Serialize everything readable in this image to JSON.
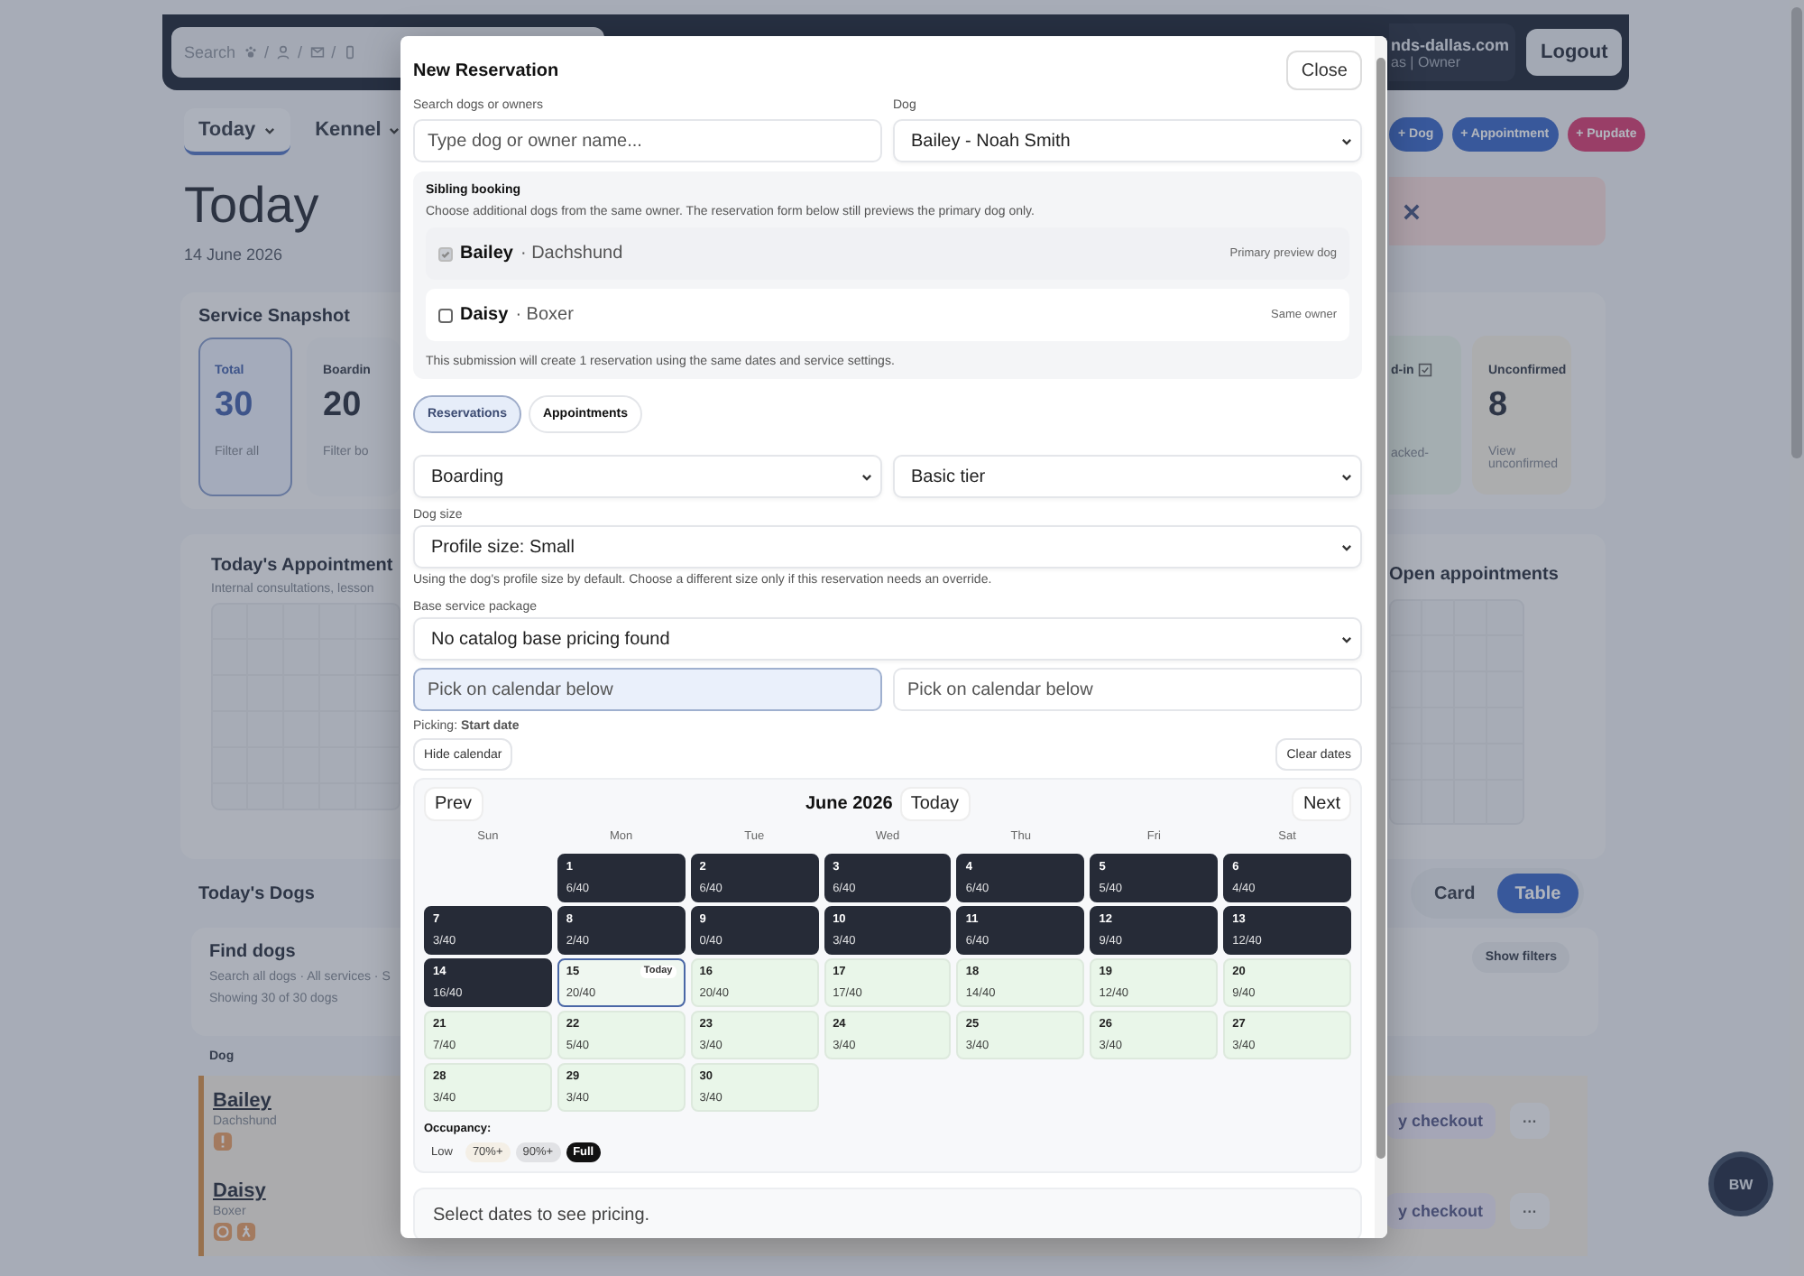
{
  "background": {
    "search": {
      "placeholder": "Search",
      "separator": "/"
    },
    "account": {
      "line1": "nds-dallas.com",
      "line2": "as | Owner"
    },
    "logout": "Logout",
    "nav_tabs": [
      {
        "label": "Today",
        "selected": true
      },
      {
        "label": "Kennel",
        "selected": false
      }
    ],
    "actions": [
      {
        "label": "+ Dog",
        "kind": "primary"
      },
      {
        "label": "+ Appointment",
        "kind": "primary"
      },
      {
        "label": "+ Pupdate",
        "kind": "accent"
      }
    ],
    "heading": "Today",
    "date": "14 June 2026",
    "snapshot": {
      "title": "Service Snapshot",
      "cards": [
        {
          "label": "Total",
          "value": "30",
          "link": "Filter all",
          "selected": true
        },
        {
          "label": "Boardin",
          "value": "20",
          "link": "Filter bo",
          "selected": false
        }
      ],
      "right_cards": [
        {
          "kind": "checkin",
          "label": "d-in",
          "link": "acked-"
        },
        {
          "kind": "unconfirmed",
          "label": "Unconfirmed",
          "value": "8",
          "link": "View unconfirmed"
        }
      ]
    },
    "appointments": {
      "title": "Today's Appointment",
      "subtitle": "Internal consultations, lesson",
      "side_title": "Open appointments"
    },
    "dogs": {
      "title": "Today's Dogs",
      "views": [
        {
          "label": "Card",
          "selected": false
        },
        {
          "label": "Table",
          "selected": true
        }
      ],
      "find_title": "Find dogs",
      "find_subtitle": "Search all dogs · All services · S",
      "showing": "Showing 30 of 30 dogs",
      "filters_button": "Show filters",
      "column": "Dog",
      "rows": [
        {
          "name": "Bailey",
          "breed": "Dachshund",
          "tags": [
            {
              "kind": "alert"
            }
          ],
          "action": "y checkout",
          "more": "···"
        },
        {
          "name": "Daisy",
          "breed": "Boxer",
          "tags": [
            {
              "kind": "food"
            },
            {
              "kind": "walk"
            }
          ],
          "action": "y checkout",
          "more": "···"
        }
      ]
    },
    "user_initials": "BW"
  },
  "modal": {
    "title": "New Reservation",
    "close": "Close",
    "search": {
      "label": "Search dogs or owners",
      "placeholder": "Type dog or owner name..."
    },
    "dog": {
      "label": "Dog",
      "value": "Bailey - Noah Smith"
    },
    "sibling": {
      "title": "Sibling booking",
      "description": "Choose additional dogs from the same owner. The reservation form below still previews the primary dog only.",
      "dogs": [
        {
          "name": "Bailey",
          "breed": "· Dachshund",
          "note": "Primary preview dog",
          "checked": true,
          "disabled": true
        },
        {
          "name": "Daisy",
          "breed": "· Boxer",
          "note": "Same owner",
          "checked": false,
          "disabled": false
        }
      ],
      "footer": "This submission will create 1 reservation using the same dates and service settings."
    },
    "tabs": [
      {
        "label": "Reservations",
        "selected": true
      },
      {
        "label": "Appointments",
        "selected": false
      }
    ],
    "service": "Boarding",
    "tier": "Basic tier",
    "size": {
      "label": "Dog size",
      "value": "Profile size: Small",
      "hint": "Using the dog's profile size by default. Choose a different size only if this reservation needs an override."
    },
    "package": {
      "label": "Base service package",
      "value": "No catalog base pricing found"
    },
    "dates": [
      {
        "placeholder": "Pick on calendar below",
        "active": true
      },
      {
        "placeholder": "Pick on calendar below",
        "active": false
      }
    ],
    "picking": "Picking: **Start date**",
    "hide_calendar": "Hide calendar",
    "clear_dates": "Clear dates",
    "calendar": {
      "prev": "Prev",
      "month": "June 2026",
      "today": "Today",
      "next": "Next",
      "weekdays": [
        "Sun",
        "Mon",
        "Tue",
        "Wed",
        "Thu",
        "Fri",
        "Sat"
      ],
      "days": [
        {
          "kind": "blank"
        },
        {
          "kind": "past",
          "day": "1",
          "count": "6/40"
        },
        {
          "kind": "past",
          "day": "2",
          "count": "6/40"
        },
        {
          "kind": "past",
          "day": "3",
          "count": "6/40"
        },
        {
          "kind": "past",
          "day": "4",
          "count": "6/40"
        },
        {
          "kind": "past",
          "day": "5",
          "count": "5/40"
        },
        {
          "kind": "past",
          "day": "6",
          "count": "4/40"
        },
        {
          "kind": "past",
          "day": "7",
          "count": "3/40"
        },
        {
          "kind": "past",
          "day": "8",
          "count": "2/40"
        },
        {
          "kind": "past",
          "day": "9",
          "count": "0/40"
        },
        {
          "kind": "past",
          "day": "10",
          "count": "3/40"
        },
        {
          "kind": "past",
          "day": "11",
          "count": "6/40"
        },
        {
          "kind": "past",
          "day": "12",
          "count": "9/40"
        },
        {
          "kind": "past",
          "day": "13",
          "count": "12/40"
        },
        {
          "kind": "past",
          "day": "14",
          "count": "16/40"
        },
        {
          "kind": "today",
          "day": "15",
          "count": "20/40",
          "badge": "Today"
        },
        {
          "kind": "open",
          "day": "16",
          "count": "20/40"
        },
        {
          "kind": "open",
          "day": "17",
          "count": "17/40"
        },
        {
          "kind": "open",
          "day": "18",
          "count": "14/40"
        },
        {
          "kind": "open",
          "day": "19",
          "count": "12/40"
        },
        {
          "kind": "open",
          "day": "20",
          "count": "9/40"
        },
        {
          "kind": "open",
          "day": "21",
          "count": "7/40"
        },
        {
          "kind": "open",
          "day": "22",
          "count": "5/40"
        },
        {
          "kind": "open",
          "day": "23",
          "count": "3/40"
        },
        {
          "kind": "open",
          "day": "24",
          "count": "3/40"
        },
        {
          "kind": "open",
          "day": "25",
          "count": "3/40"
        },
        {
          "kind": "open",
          "day": "26",
          "count": "3/40"
        },
        {
          "kind": "open",
          "day": "27",
          "count": "3/40"
        },
        {
          "kind": "open",
          "day": "28",
          "count": "3/40"
        },
        {
          "kind": "open",
          "day": "29",
          "count": "3/40"
        },
        {
          "kind": "open",
          "day": "30",
          "count": "3/40"
        }
      ],
      "legend_title": "Occupancy:",
      "legend": [
        {
          "kind": "low",
          "label": "Low"
        },
        {
          "kind": "high",
          "label": "70%+"
        },
        {
          "kind": "critical",
          "label": "90%+"
        },
        {
          "kind": "full",
          "label": "Full"
        }
      ]
    },
    "pricing": "Select dates to see pricing."
  }
}
